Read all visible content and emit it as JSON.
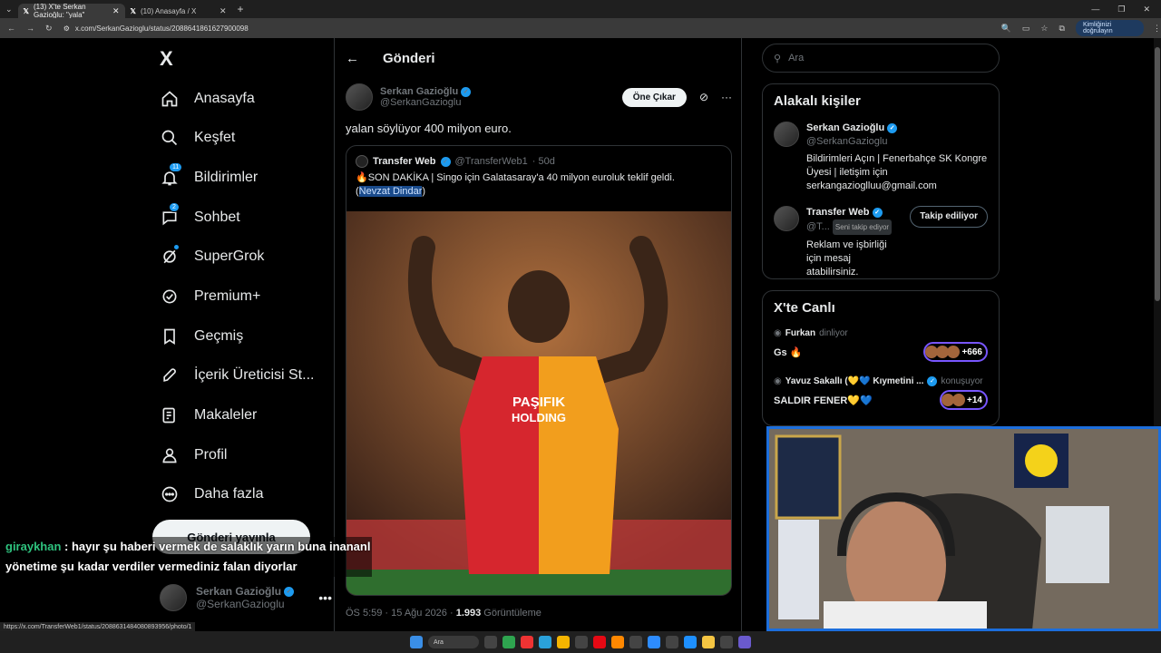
{
  "browser": {
    "tabs": [
      {
        "title": "(13) X'te Serkan Gazioğlu: \"yala\"",
        "active": true
      },
      {
        "title": "(10) Anasayfa / X",
        "active": false
      }
    ],
    "url": "x.com/SerkanGazioglu/status/2088641861627900098",
    "verify_label": "Kimliğinizi doğrulayın",
    "status_url": "https://x.com/TransferWeb1/status/2088631484080893956/photo/1"
  },
  "nav": {
    "logo": "X",
    "items": [
      {
        "label": "Anasayfa",
        "icon": "home-icon"
      },
      {
        "label": "Keşfet",
        "icon": "search-icon"
      },
      {
        "label": "Bildirimler",
        "icon": "bell-icon",
        "badge": "11"
      },
      {
        "label": "Sohbet",
        "icon": "chat-icon",
        "badge": "2"
      },
      {
        "label": "SuperGrok",
        "icon": "grok-icon"
      },
      {
        "label": "Premium+",
        "icon": "verified-icon"
      },
      {
        "label": "Geçmiş",
        "icon": "bookmark-icon"
      },
      {
        "label": "İçerik Üreticisi St...",
        "icon": "rocket-icon"
      },
      {
        "label": "Makaleler",
        "icon": "article-icon"
      },
      {
        "label": "Profil",
        "icon": "person-icon"
      },
      {
        "label": "Daha fazla",
        "icon": "more-circle-icon"
      }
    ],
    "post_button": "Gönderi yayınla",
    "me": {
      "name": "Serkan Gazioğlu",
      "handle": "@SerkanGazioglu"
    }
  },
  "main": {
    "header": "Gönderi",
    "author": {
      "name": "Serkan Gazioğlu",
      "handle": "@SerkanGazioglu"
    },
    "pin_button": "Öne Çıkar",
    "text": "yalan söylüyor 400 milyon euro.",
    "quote": {
      "name": "Transfer Web",
      "handle": "@TransferWeb1",
      "time": "· 50d",
      "text": "🔥SON DAKİKA | Singo için Galatasaray'a 40 milyon euroluk teklif geldi.",
      "source_open": "(",
      "source": "Nevzat Dindar",
      "source_close": ")"
    },
    "meta": {
      "time": "ÖS 5:59 · 15 Ağu 2026 ·",
      "views": "1.993",
      "views_label": "Görüntüleme"
    }
  },
  "right": {
    "search_placeholder": "Ara",
    "related_title": "Alakalı kişiler",
    "people": [
      {
        "name": "Serkan Gazioğlu",
        "handle": "@SerkanGazioglu",
        "bio": "Bildirimleri Açın | Fenerbahçe SK Kongre Üyesi | iletişim için serkangazioglluu@gmail.com"
      },
      {
        "name": "Transfer Web",
        "handle": "@T...",
        "follows_you": "Seni takip ediyor",
        "bio": "Reklam ve işbirliği için mesaj atabilirsiniz.",
        "button": "Takip ediliyor"
      }
    ],
    "live_title": "X'te Canlı",
    "live": [
      {
        "host": "Furkan",
        "status": "dinliyor",
        "title": "Gs 🔥",
        "count": "+666"
      },
      {
        "host": "Yavuz Sakallı (💛💙 Kıymetini ...",
        "status": "konuşuyor",
        "title": "SALDIR FENER💛💙",
        "count": "+14"
      }
    ]
  },
  "overlay": {
    "chat_user": "giraykhan",
    "chat_line1": ": hayır şu haberi vermek de salaklık yarın buna inananl",
    "chat_line2": "yönetime şu kadar verdiler vermediniz falan diyorlar"
  },
  "taskbar": {
    "search": "Ara"
  }
}
